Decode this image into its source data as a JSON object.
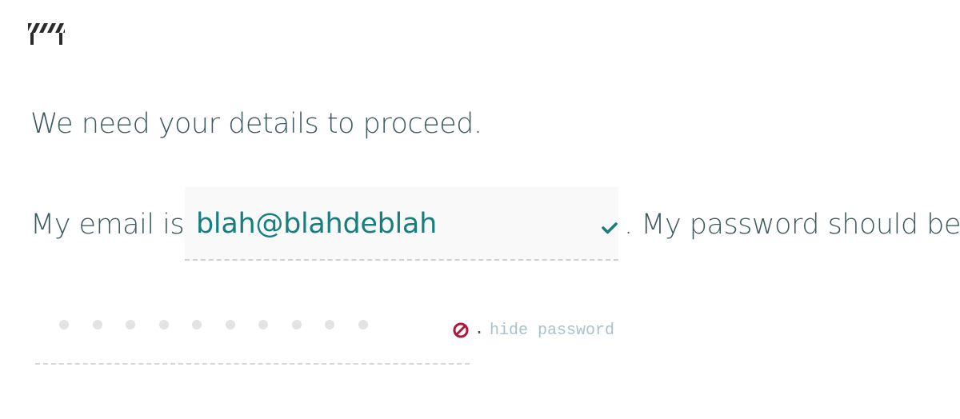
{
  "logo": {
    "icon": "roadblock-icon"
  },
  "form": {
    "heading": "We need your details to proceed.",
    "email_prefix": "My email is",
    "email_value": "blah@blahdeblah",
    "email_status_icon": "checkmark-icon",
    "password_prefix": ". My password should be",
    "password_masked_length": 10,
    "password_status_icon": "blocked-icon",
    "password_suffix": ".",
    "toggle_label": "hide password"
  },
  "colors": {
    "text": "#3d5a60",
    "accent_teal": "#167f7e",
    "error_red": "#b0173a",
    "link_muted": "#a8c2cc",
    "input_bg": "#f9f9f9"
  }
}
